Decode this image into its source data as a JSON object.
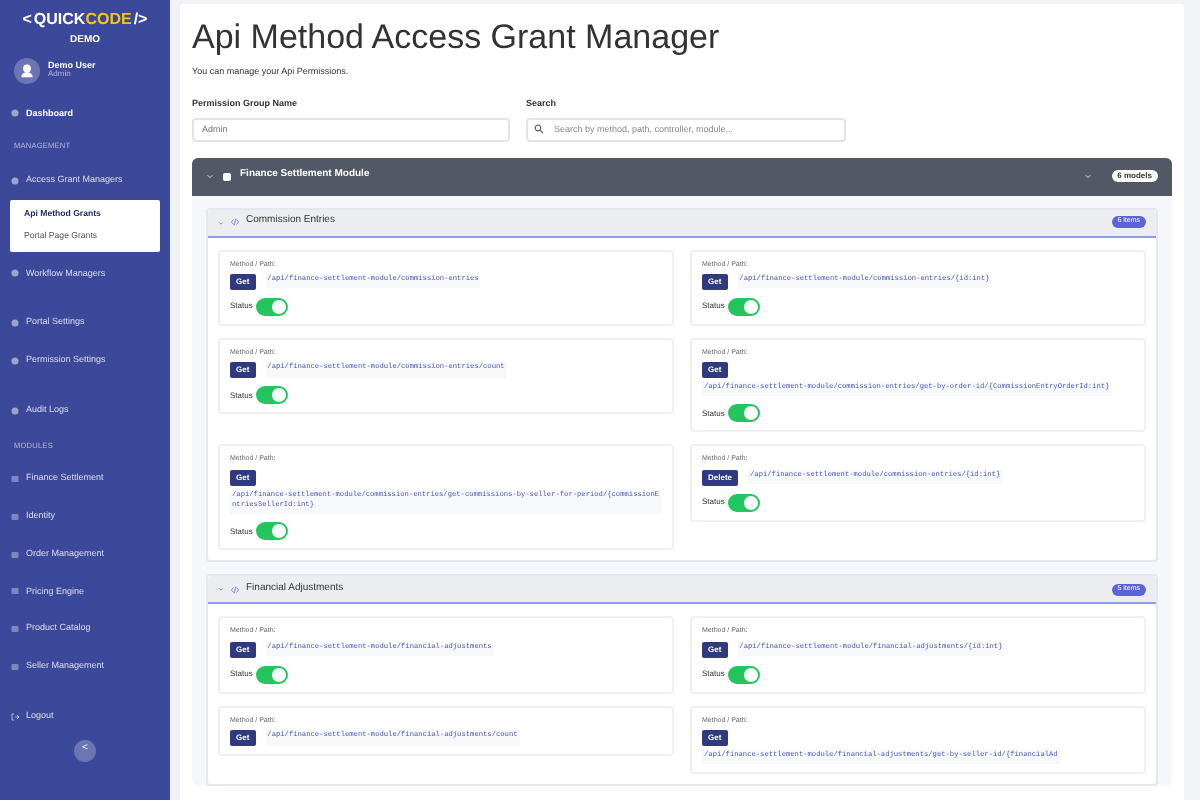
{
  "sidebar": {
    "logo": {
      "left": "<",
      "brand_a": "QUICK",
      "brand_b": "CODE",
      "right": "/>"
    },
    "subtitle": "DEMO",
    "user": {
      "name": "Demo User",
      "role": "Admin"
    },
    "items": [
      {
        "kind": "link",
        "label": "Dashboard",
        "selected": true
      },
      {
        "kind": "section",
        "label": "MANAGEMENT"
      },
      {
        "kind": "link",
        "label": "Access Grant Managers",
        "selected": false,
        "expanded": true,
        "children": [
          {
            "label": "Api Method Grants",
            "selected": true
          },
          {
            "label": "Portal Page Grants",
            "selected": false
          }
        ]
      },
      {
        "kind": "link",
        "label": "Workflow Managers",
        "selected": false
      },
      {
        "kind": "link",
        "label": "Portal Settings",
        "selected": false
      },
      {
        "kind": "link",
        "label": "Permission Settings",
        "selected": false
      },
      {
        "kind": "link",
        "label": "Audit Logs",
        "selected": false
      },
      {
        "kind": "section",
        "label": "MODULES"
      },
      {
        "kind": "module",
        "label": "Finance Settlement",
        "selected": false
      },
      {
        "kind": "module",
        "label": "Identity",
        "selected": false
      },
      {
        "kind": "module",
        "label": "Order Management",
        "selected": false
      },
      {
        "kind": "module",
        "label": "Pricing Engine",
        "selected": false
      },
      {
        "kind": "module",
        "label": "Product Catalog",
        "selected": false
      },
      {
        "kind": "module",
        "label": "Seller Management",
        "selected": false
      },
      {
        "kind": "logout",
        "label": "Logout"
      }
    ],
    "collapse": "<"
  },
  "page": {
    "title": "Api Method Access Grant Manager",
    "subtitle": "You can manage your Api Permissions.",
    "group_field": {
      "label": "Permission Group Name",
      "value": "Admin"
    },
    "search": {
      "label": "Search",
      "placeholder": "Search by method, path, controller, module..."
    }
  },
  "module": {
    "title": "Finance Settlement Module",
    "badge": "6 models",
    "expanded": true,
    "groups": [
      {
        "title": "Commission Entries",
        "badge": "6 items",
        "endpoints": [
          {
            "label": "Method / Path:",
            "method": "Get",
            "path": "/api/finance-settlement-module/commission-entries",
            "status_label": "Status",
            "on": true
          },
          {
            "label": "Method / Path:",
            "method": "Get",
            "path": "/api/finance-settlement-module/commission-entries/{id:int}",
            "status_label": "Status",
            "on": true
          },
          {
            "label": "Method / Path:",
            "method": "Get",
            "path": "/api/finance-settlement-module/commission-entries/count",
            "status_label": "Status",
            "on": true
          },
          {
            "label": "Method / Path:",
            "method": "Get",
            "path": "/api/finance-settlement-module/commission-entries/get-by-order-id/{CommissionEntryOrderId:int}",
            "status_label": "Status",
            "on": true
          },
          {
            "label": "Method / Path:",
            "method": "Get",
            "path": "/api/finance-settlement-module/commission-entries/get-commissions-by-seller-for-period/{commissionEntriesSellerId:int}",
            "status_label": "Status",
            "on": true
          },
          {
            "label": "Method / Path:",
            "method": "Delete",
            "path": "/api/finance-settlement-module/commission-entries/{id:int}",
            "status_label": "Status",
            "on": true
          }
        ]
      },
      {
        "title": "Financial Adjustments",
        "badge": "5 items",
        "endpoints": [
          {
            "label": "Method / Path:",
            "method": "Get",
            "path": "/api/finance-settlement-module/financial-adjustments",
            "status_label": "Status",
            "on": true
          },
          {
            "label": "Method / Path:",
            "method": "Get",
            "path": "/api/finance-settlement-module/financial-adjustments/{id:int}",
            "status_label": "Status",
            "on": true
          },
          {
            "label": "Method / Path:",
            "method": "Get",
            "path": "/api/finance-settlement-module/financial-adjustments/count"
          },
          {
            "label": "Method / Path:",
            "method": "Get",
            "path": "/api/finance-settlement-module/financial-adjustments/get-by-seller-id/{financialAd"
          }
        ]
      }
    ]
  }
}
